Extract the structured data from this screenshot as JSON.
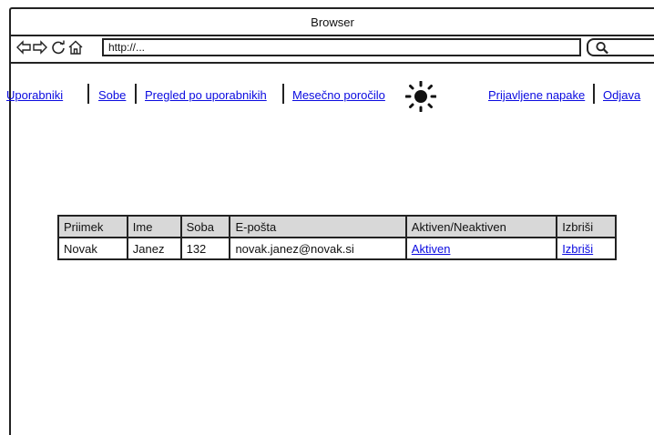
{
  "browser": {
    "title": "Browser",
    "address": "http://...",
    "nav_icons": [
      "back-icon",
      "forward-icon",
      "reload-icon",
      "home-icon",
      "search-icon"
    ]
  },
  "menu": {
    "users": "Uporabniki",
    "rooms": "Sobe",
    "overview": "Pregled po uporabnikih",
    "monthly": "Mesečno poročilo",
    "bugs": "Prijavljene napake",
    "logout": "Odjava"
  },
  "table": {
    "headers": [
      "Priimek",
      "Ime",
      "Soba",
      "E-pošta",
      "Aktiven/Neaktiven",
      "Izbriši"
    ],
    "rows": [
      {
        "surname": "Novak",
        "name": "Janez",
        "room": "132",
        "email": "novak.janez@novak.si",
        "status": "Aktiven",
        "delete": "Izbriši"
      }
    ]
  },
  "colors": {
    "link": "#0a0ae0",
    "header_bg": "#d8d8d8"
  }
}
